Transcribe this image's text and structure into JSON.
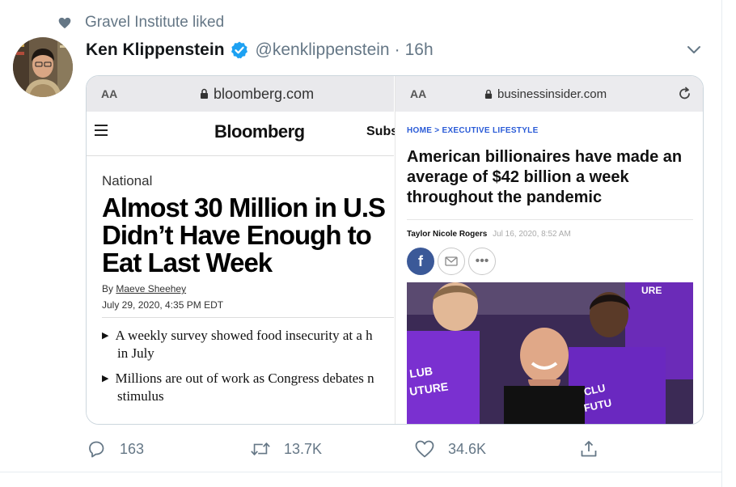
{
  "social_context": {
    "text": "Gravel Institute liked",
    "icon": "heart-icon"
  },
  "tweet": {
    "display_name": "Ken Klippenstein",
    "verified": true,
    "handle": "@kenklippenstein",
    "separator": "·",
    "time": "16h"
  },
  "media_left": {
    "aa_label": "AA",
    "url": "bloomberg.com",
    "logo": "Bloomberg",
    "subscribe": "Subs",
    "section": "National",
    "headline_lines": [
      "Almost 30 Million in U.S",
      "Didn’t Have Enough to",
      "Eat Last Week"
    ],
    "byline_prefix": "By",
    "author": "Maeve Sheehey",
    "date": "July 29, 2020, 4:35 PM EDT",
    "bullets": [
      {
        "line1": "A weekly survey showed food insecurity at a h",
        "line2": "in July"
      },
      {
        "line1": "Millions are out of work as Congress debates n",
        "line2": "stimulus"
      }
    ]
  },
  "media_right": {
    "aa_label": "AA",
    "url": "businessinsider.com",
    "breadcrumb": "HOME  >  EXECUTIVE LIFESTYLE",
    "headline": "American billionaires have made an average of $42 billion a week throughout the pandemic",
    "author": "Taylor Nicole Rogers",
    "date": "Jul 16, 2020, 8:52 AM",
    "share_fb": "f",
    "share_more": "•••"
  },
  "actions": {
    "reply_count": "163",
    "retweet_count": "13.7K",
    "like_count": "34.6K"
  },
  "colors": {
    "verified": "#1da1f2",
    "secondary_text": "#657786",
    "border": "#e6ecf0",
    "bi_link": "#2a5bd7",
    "fb": "#3b5998"
  }
}
